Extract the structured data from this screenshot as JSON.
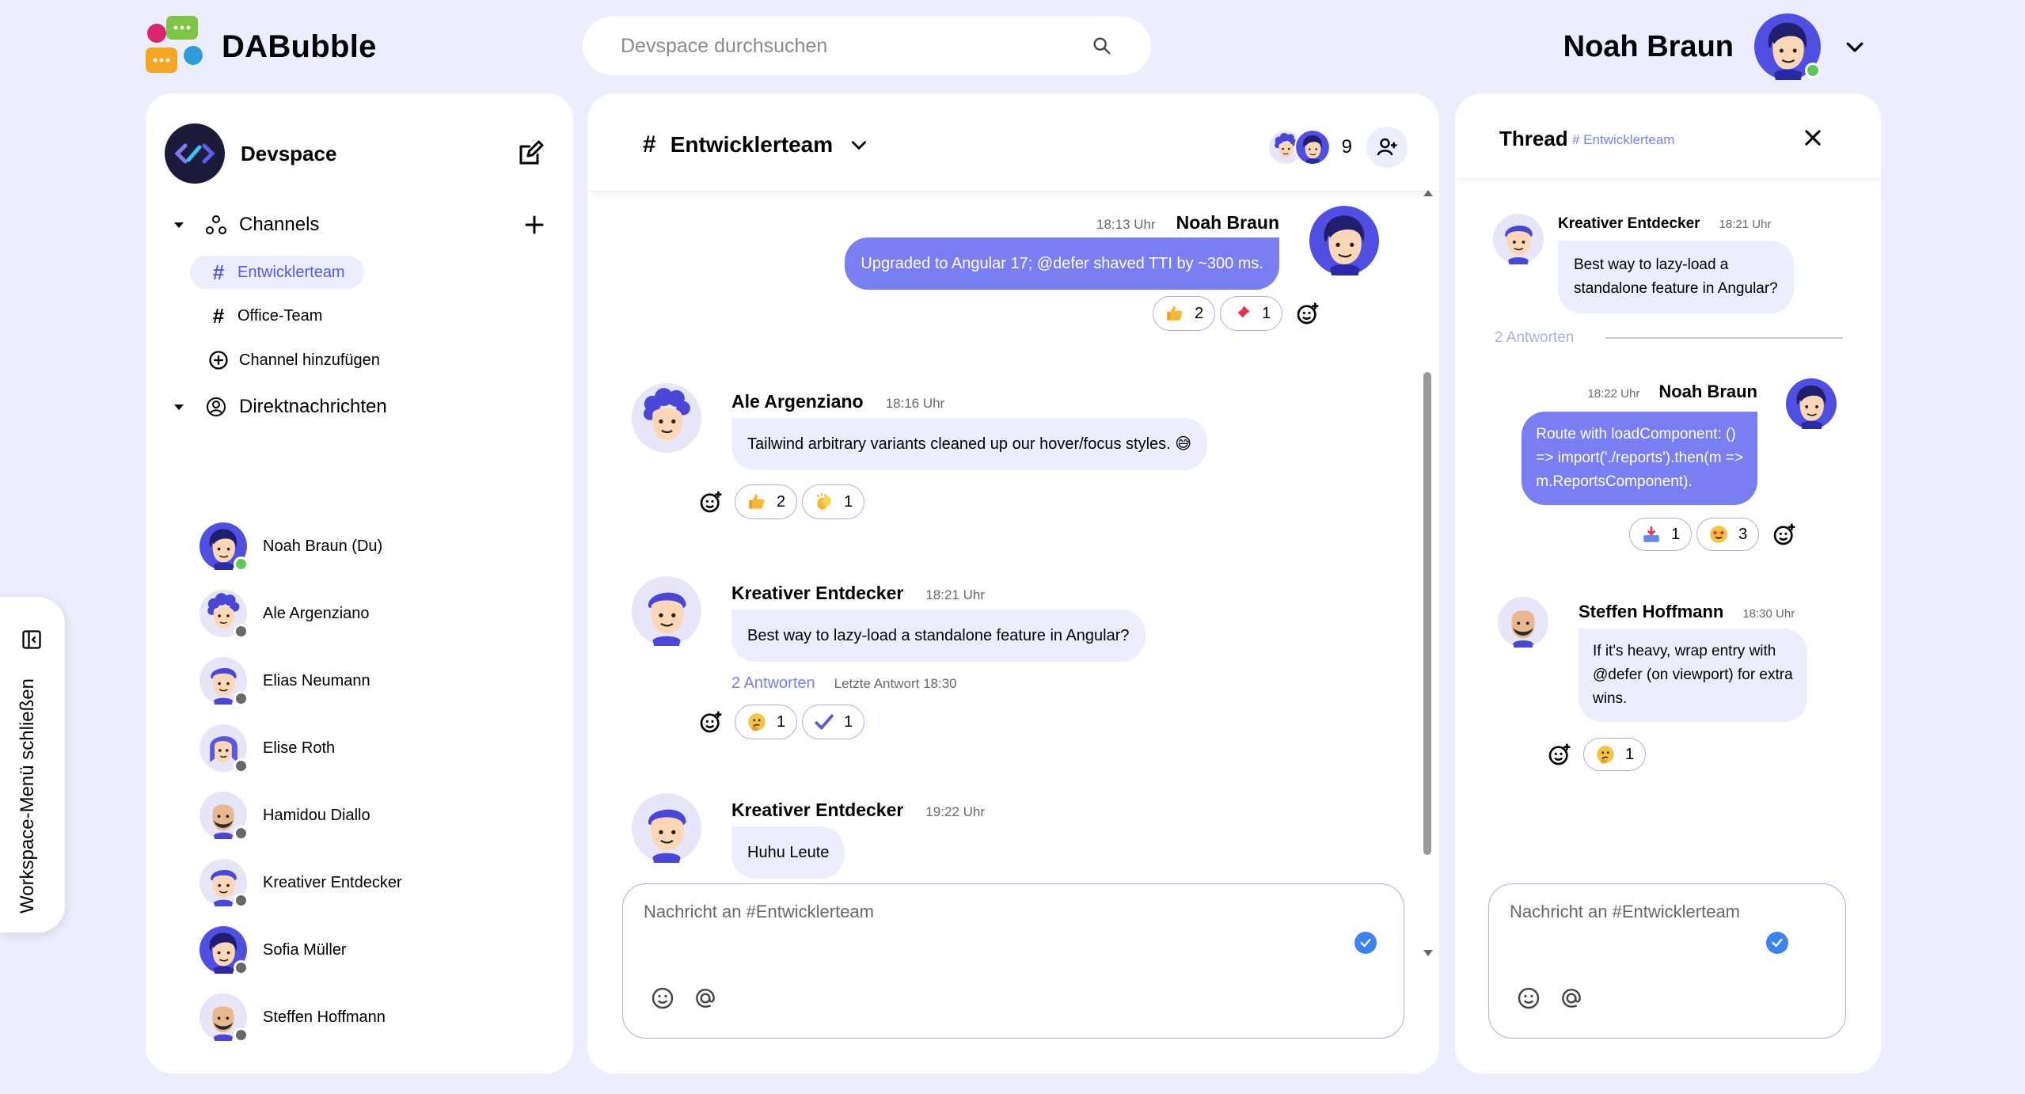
{
  "app": {
    "name": "DABubble",
    "search_placeholder": "Devspace durchsuchen"
  },
  "current_user": {
    "name": "Noah Braun",
    "status": "online"
  },
  "workspace": {
    "name": "Devspace",
    "channels_label": "Channels",
    "channels": [
      {
        "name": "Entwicklerteam",
        "active": true
      },
      {
        "name": "Office-Team",
        "active": false
      }
    ],
    "add_channel_label": "Channel hinzufügen",
    "dms_label": "Direktnachrichten",
    "dms": [
      {
        "name": "Noah Braun (Du)",
        "status": "online"
      },
      {
        "name": "Ale Argenziano",
        "status": "offline"
      },
      {
        "name": "Elias Neumann",
        "status": "offline"
      },
      {
        "name": "Elise Roth",
        "status": "offline"
      },
      {
        "name": "Hamidou Diallo",
        "status": "offline"
      },
      {
        "name": "Kreativer Entdecker",
        "status": "offline"
      },
      {
        "name": "Sofia Müller",
        "status": "offline"
      },
      {
        "name": "Steffen Hoffmann",
        "status": "offline"
      }
    ],
    "toggle_label": "Workspace-Menü schließen"
  },
  "channel": {
    "hash": "#",
    "name": "Entwicklerteam",
    "member_count": "9",
    "messages": [
      {
        "author": "Noah Braun",
        "time": "18:13 Uhr",
        "text": "Upgraded to Angular 17; @defer shaved TTI by ~300 ms.",
        "mine": true,
        "reactions": [
          {
            "emoji": "thumbs-up-icon",
            "count": "2"
          },
          {
            "emoji": "pushpin-icon",
            "count": "1"
          }
        ]
      },
      {
        "author": "Ale Argenziano",
        "time": "18:16 Uhr",
        "text": "Tailwind arbitrary variants cleaned up our hover/focus styles. 😅",
        "mine": false,
        "reactions": [
          {
            "emoji": "thumbs-up-icon",
            "count": "2"
          },
          {
            "emoji": "clapping-icon",
            "count": "1"
          }
        ]
      },
      {
        "author": "Kreativer Entdecker",
        "time": "18:21 Uhr",
        "text": "Best way to lazy-load a standalone feature in Angular?",
        "mine": false,
        "replies": "2 Antworten",
        "last_reply": "Letzte Antwort 18:30",
        "reactions": [
          {
            "emoji": "thinking-face-icon",
            "count": "1"
          },
          {
            "emoji": "check-mark-icon",
            "count": "1"
          }
        ]
      },
      {
        "author": "Kreativer Entdecker",
        "time": "19:22 Uhr",
        "text": "Huhu Leute",
        "mine": false
      }
    ],
    "composer_placeholder": "Nachricht an #Entwicklerteam"
  },
  "thread": {
    "title": "Thread",
    "channel": "# Entwicklerteam",
    "root": {
      "author": "Kreativer Entdecker",
      "time": "18:21 Uhr",
      "text_lines": [
        "Best way to lazy-load a",
        "standalone feature in Angular?"
      ]
    },
    "replies_count": "2 Antworten",
    "replies": [
      {
        "author": "Noah Braun",
        "time": "18:22 Uhr",
        "text_lines": [
          "Route with loadComponent: ()",
          "=> import('./reports').then(m =>",
          "m.ReportsComponent)."
        ],
        "mine": true,
        "reactions": [
          {
            "emoji": "inbox-tray-icon",
            "count": "1"
          },
          {
            "emoji": "star-struck-icon",
            "count": "3"
          }
        ]
      },
      {
        "author": "Steffen Hoffmann",
        "time": "18:30 Uhr",
        "text_lines": [
          "If it's heavy, wrap entry with",
          "@defer (on viewport) for extra",
          "wins."
        ],
        "mine": false,
        "reactions": [
          {
            "emoji": "thinking-face-icon",
            "count": "1"
          }
        ]
      }
    ],
    "composer_placeholder": "Nachricht an #Entwicklerteam"
  },
  "colors": {
    "background": "#eceefe",
    "accent": "#535af1",
    "bubble_mine": "#797ef3",
    "bubble_other": "#eceefe",
    "online": "#5cc85a",
    "offline": "#686868",
    "send": "#3b82f6"
  }
}
